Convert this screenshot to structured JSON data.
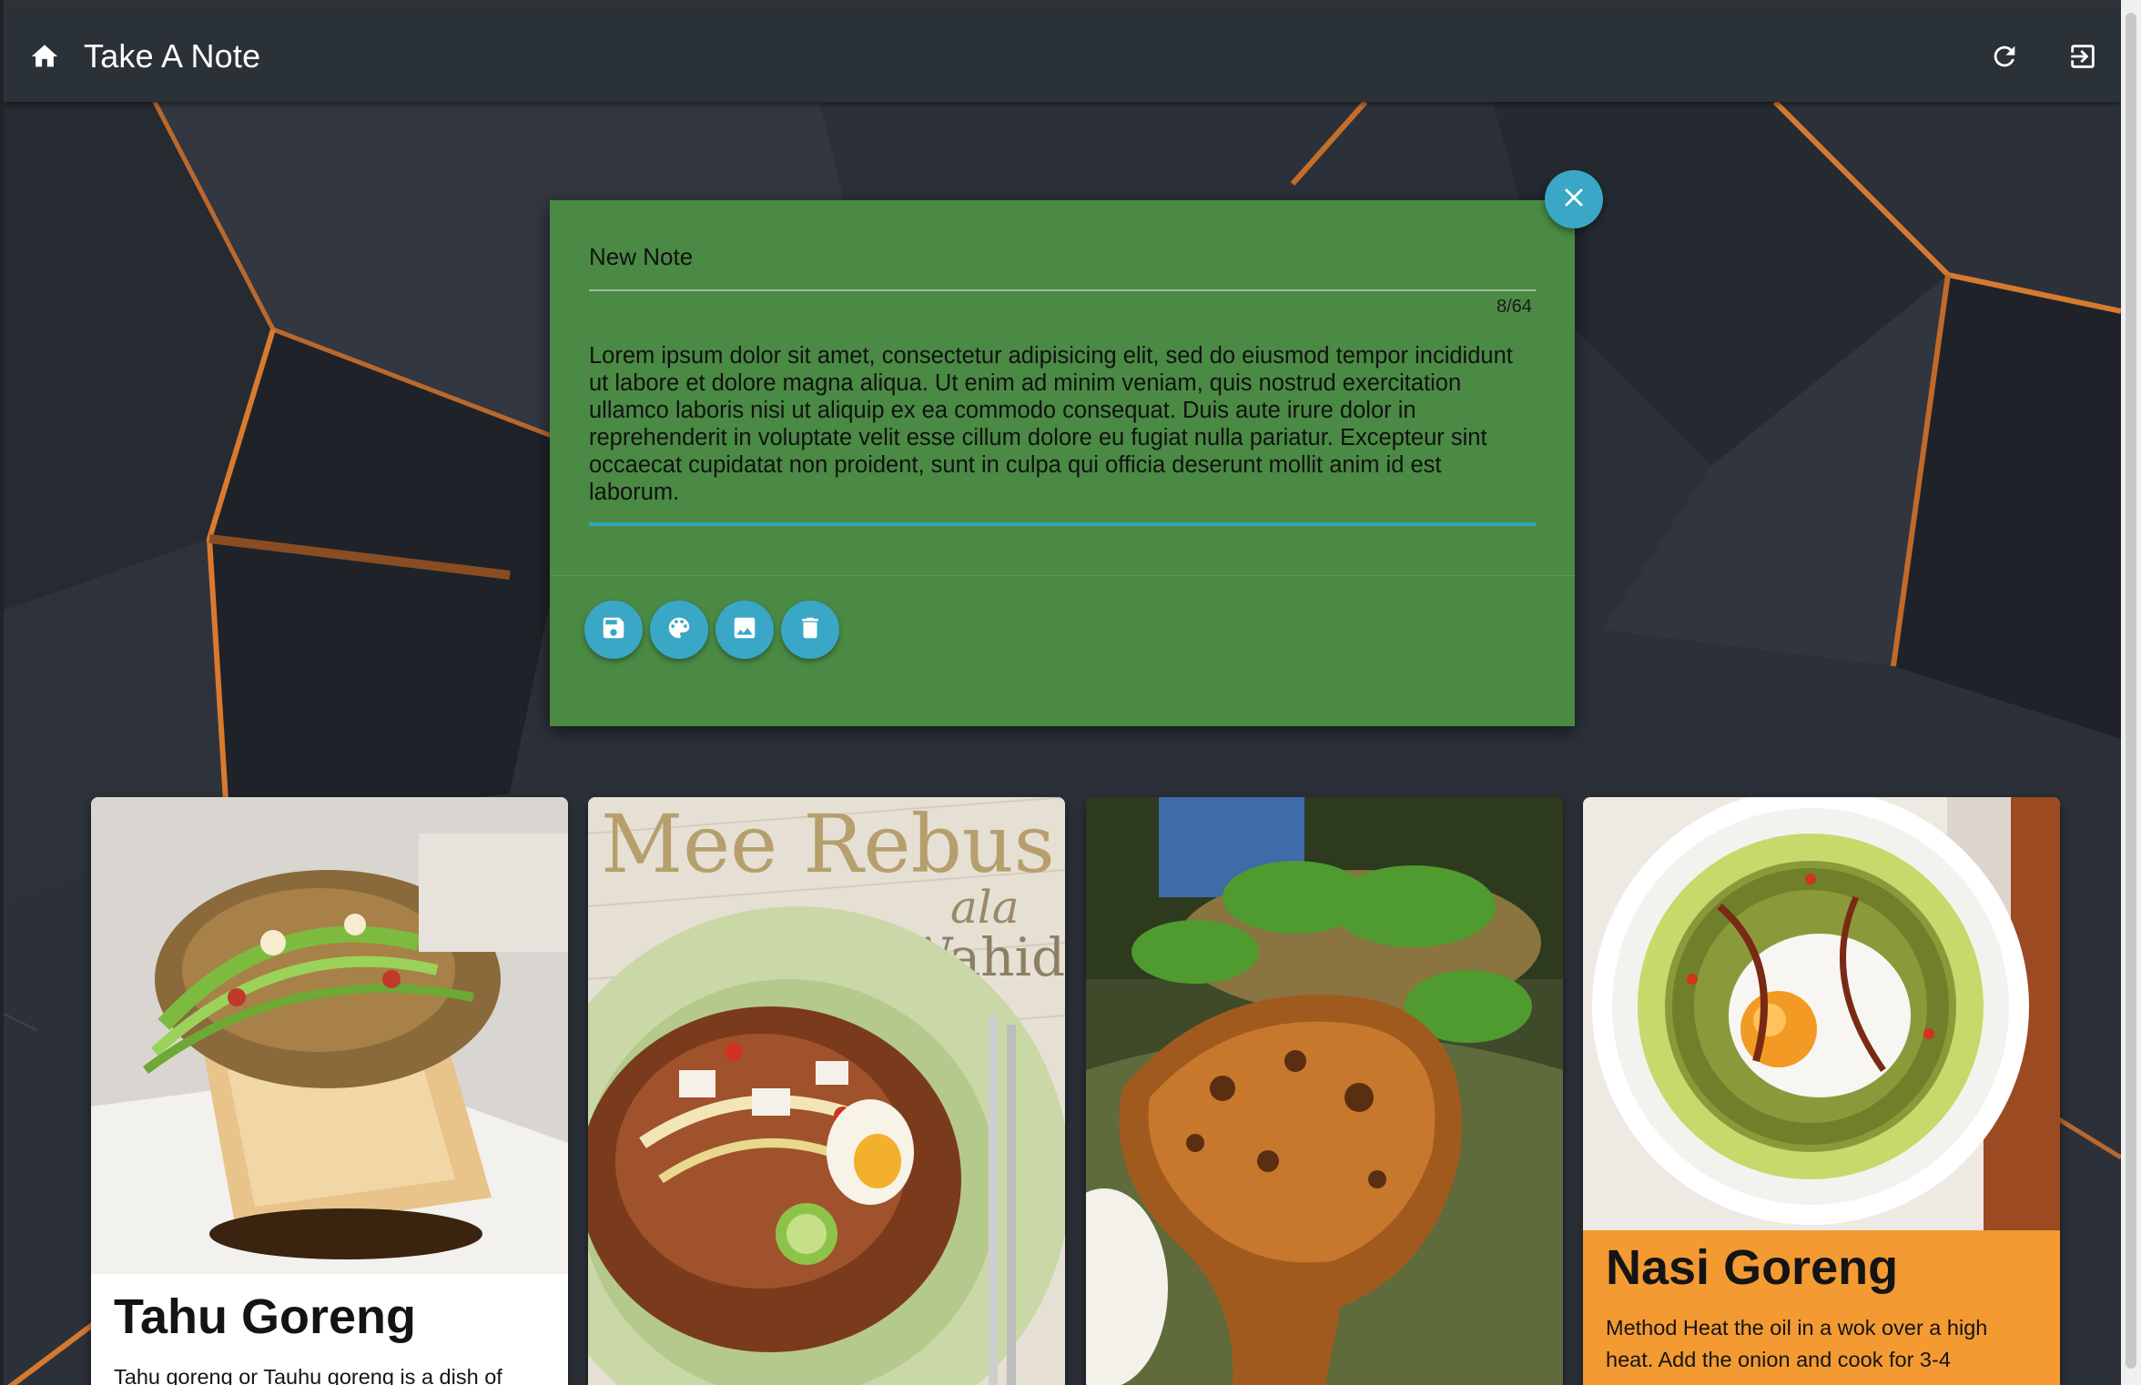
{
  "appbar": {
    "title": "Take A Note",
    "icons": [
      "home-icon",
      "refresh-icon",
      "logout-icon"
    ]
  },
  "editor": {
    "background_color": "#4a8a44",
    "title_value": "New Note",
    "counter": "8/64",
    "body_value": "Lorem ipsum dolor sit amet, consectetur adipisicing elit, sed do eiusmod tempor incididunt ut labore et dolore magna aliqua. Ut enim ad minim veniam, quis nostrud exercitation ullamco laboris nisi ut aliquip ex ea commodo consequat. Duis aute irure dolor in reprehenderit in voluptate velit esse cillum dolore eu fugiat nulla pariatur. Excepteur sint occaecat cupidatat non proident, sunt in culpa qui officia deserunt mollit anim id est laborum.",
    "actions": [
      "save-icon",
      "palette-icon",
      "image-icon",
      "delete-icon"
    ],
    "accent_color": "#3aa7c7"
  },
  "cards": [
    {
      "title": "Tahu Goreng",
      "description": "Tahu goreng or Tauhu goreng is a dish of",
      "background": "#ffffff"
    },
    {
      "image_text_1": "Mee Rebus",
      "image_text_2": "ala",
      "image_text_3": "Hj Wahid"
    },
    {},
    {
      "title": "Nasi Goreng",
      "description": "Method Heat the oil in a wok over a high heat. Add the onion and cook for 3-4",
      "background": "#f39a33"
    }
  ]
}
